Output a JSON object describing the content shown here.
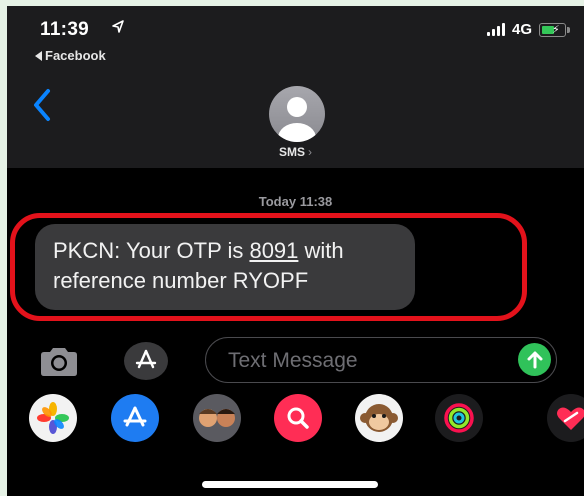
{
  "status_bar": {
    "time": "11:39",
    "back_app": "Facebook",
    "network": "4G",
    "colors": {
      "battery": "#34c759"
    }
  },
  "conversation": {
    "contact_name": "SMS",
    "timestamp": "Today 11:38"
  },
  "message": {
    "part1": "PKCN: Your OTP is ",
    "otp": "8091",
    "part2": " with reference number RYOPF",
    "highlight_color": "#e3121b"
  },
  "composer": {
    "placeholder": "Text Message",
    "send_color": "#30c25a"
  },
  "app_drawer": {
    "icons": [
      "photos-icon",
      "app-store-icon",
      "memoji-icon",
      "image-search-icon",
      "animoji-icon",
      "activity-icon",
      "digital-touch-icon"
    ]
  }
}
